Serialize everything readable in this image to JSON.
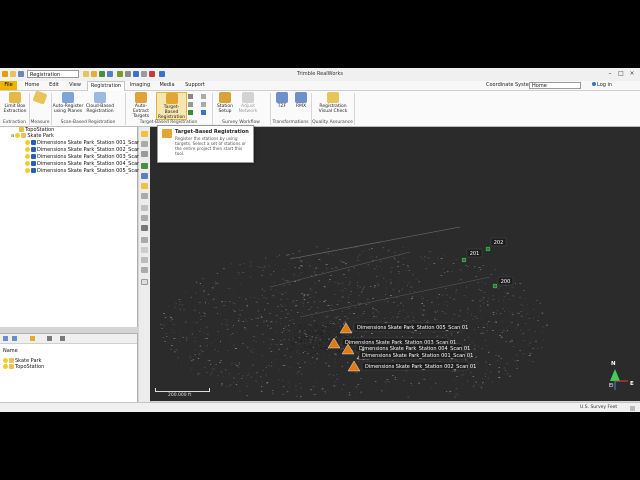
{
  "app": {
    "title": "Trimble RealWorks",
    "project_select": "Registration"
  },
  "menu": {
    "items": [
      "File",
      "Home",
      "Edit",
      "View",
      "Registration",
      "Imaging",
      "Media",
      "Support"
    ],
    "coord_system_label": "Coordinate System",
    "coord_system_value": "Home",
    "login": "Log in"
  },
  "ribbon": {
    "buttons": [
      {
        "label1": "Limit Box",
        "label2": "Extraction",
        "icon": "limit-box-icon"
      },
      {
        "label1": "Measure",
        "label2": "",
        "icon": "measure-icon"
      },
      {
        "label1": "Auto-Register",
        "label2": "using Planes",
        "icon": "auto-register-planes-icon"
      },
      {
        "label1": "Cloud-Based",
        "label2": "Registration",
        "icon": "cloud-based-registration-icon"
      },
      {
        "label1": "Auto-Extract",
        "label2": "Targets",
        "icon": "auto-extract-targets-icon"
      },
      {
        "label1": "Target-Based",
        "label2": "Registration",
        "icon": "target-based-registration-icon"
      },
      {
        "label1": "Station",
        "label2": "Setup",
        "icon": "station-setup-icon"
      },
      {
        "label1": "Adjust",
        "label2": "Network",
        "icon": "adjust-network-icon"
      },
      {
        "label1": "TZF",
        "label2": "",
        "icon": "tzf-icon"
      },
      {
        "label1": "RMX",
        "label2": "",
        "icon": "rmx-icon"
      },
      {
        "label1": "Registration",
        "label2": "Visual Check",
        "icon": "registration-visual-check-icon"
      }
    ],
    "groups": [
      "Extraction",
      "Measure",
      "Scan-Based Registration",
      "Target-Based Registration",
      "Survey Workflow",
      "Transformations",
      "Quality Assurance"
    ]
  },
  "tooltip": {
    "title": "Target-Based Registration",
    "body": "Register the stations by using targets. Select a set of stations or the entire project then start this tool."
  },
  "tree": {
    "partial_top": "TopoStation",
    "root": "Skate Park",
    "scans": [
      "Dimensions Skate Park_Station 001_Scan 01",
      "Dimensions Skate Park_Station 002_Scan 01",
      "Dimensions Skate Park_Station 003_Scan 01",
      "Dimensions Skate Park_Station 004_Scan 01",
      "Dimensions Skate Park_Station 005_Scan 01"
    ]
  },
  "properties": {
    "header": "Name",
    "items": [
      "Skate Park",
      "TopoStation"
    ]
  },
  "viewport": {
    "targets": [
      "201",
      "202",
      "200"
    ],
    "stations": [
      "Dimensions Skate Park_Station 005_Scan 01",
      "Dimensions Skate Park_Station 003_Scan 01",
      "Dimensions Skate Park_Station 004_Scan 01",
      "Dimensions Skate Park_Station 001_Scan 01",
      "Dimensions Skate Park_Station 002_Scan 01"
    ],
    "scale_label": "200.000 ft",
    "compass": {
      "north": "N",
      "east": "E",
      "elevation": "El"
    }
  },
  "status": {
    "units": "U.S. Survey Feet"
  },
  "colors": {
    "file_tab": "#f0b400",
    "target_green": "#3ecf5a",
    "station_orange": "#e07b12",
    "viewport_bg": "#2b2b2b"
  }
}
